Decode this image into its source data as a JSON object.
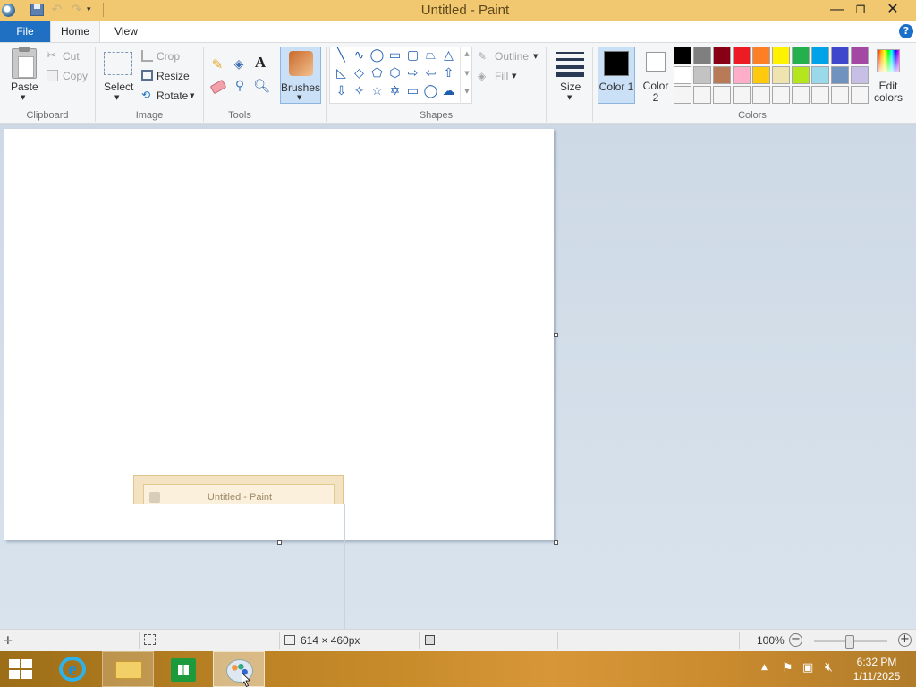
{
  "window": {
    "title": "Untitled - Paint"
  },
  "tabs": {
    "file": "File",
    "home": "Home",
    "view": "View"
  },
  "clipboard": {
    "paste": "Paste",
    "cut": "Cut",
    "copy": "Copy",
    "group": "Clipboard"
  },
  "image": {
    "select": "Select",
    "crop": "Crop",
    "resize": "Resize",
    "rotate": "Rotate",
    "group": "Image"
  },
  "tools": {
    "group": "Tools",
    "text_glyph": "A"
  },
  "brushes": {
    "label": "Brushes"
  },
  "shapes": {
    "outline": "Outline",
    "fill": "Fill",
    "group": "Shapes"
  },
  "size": {
    "label": "Size"
  },
  "colors": {
    "color1_label": "Color 1",
    "color2_label": "Color 2",
    "edit_label": "Edit colors",
    "group": "Colors",
    "color1_value": "#000000",
    "color2_value": "#ffffff",
    "palette_row1": [
      "#000000",
      "#7f7f7f",
      "#880015",
      "#ed1c24",
      "#ff7f27",
      "#fff200",
      "#22b14c",
      "#00a2e8",
      "#3f48cc",
      "#a349a4"
    ],
    "palette_row2": [
      "#ffffff",
      "#c3c3c3",
      "#b97a57",
      "#ffaec9",
      "#ffc90e",
      "#efe4b0",
      "#b5e61d",
      "#99d9ea",
      "#7092be",
      "#c8bfe7"
    ],
    "palette_row3": [
      "#f5f5f5",
      "#f5f5f5",
      "#f5f5f5",
      "#f5f5f5",
      "#f5f5f5",
      "#f5f5f5",
      "#f5f5f5",
      "#f5f5f5",
      "#f5f5f5",
      "#f5f5f5"
    ]
  },
  "taskbar_preview": {
    "title": "Untitled - Paint"
  },
  "status": {
    "canvas_size": "614 × 460px",
    "zoom": "100%",
    "zoom_level": 100
  },
  "tray": {
    "time": "6:32 PM",
    "date": "1/11/2025"
  }
}
